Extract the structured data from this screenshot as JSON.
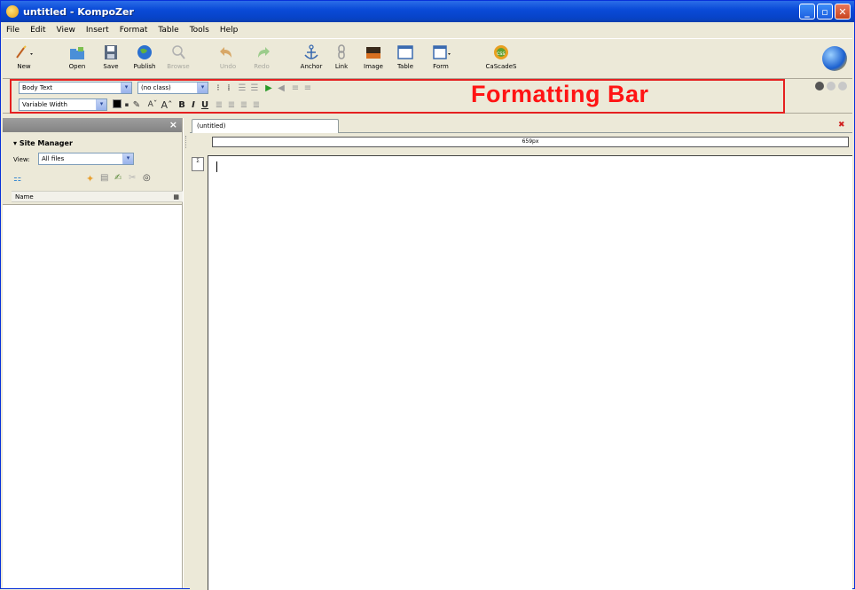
{
  "window": {
    "title": "untitled - KompoZer"
  },
  "menu": [
    "File",
    "Edit",
    "View",
    "Insert",
    "Format",
    "Table",
    "Tools",
    "Help"
  ],
  "toolbar": {
    "items": [
      {
        "label": "New",
        "icon": "new-page-icon",
        "enabled": true
      },
      {
        "label": "Open",
        "icon": "open-folder-icon",
        "enabled": true
      },
      {
        "label": "Save",
        "icon": "save-disk-icon",
        "enabled": true
      },
      {
        "label": "Publish",
        "icon": "publish-globe-icon",
        "enabled": true
      },
      {
        "label": "Browse",
        "icon": "browse-magnifier-icon",
        "enabled": false
      },
      {
        "label": "Undo",
        "icon": "undo-arrow-icon",
        "enabled": false
      },
      {
        "label": "Redo",
        "icon": "redo-arrow-icon",
        "enabled": false
      },
      {
        "label": "Anchor",
        "icon": "anchor-icon",
        "enabled": true
      },
      {
        "label": "Link",
        "icon": "link-chain-icon",
        "enabled": true
      },
      {
        "label": "Image",
        "icon": "image-icon",
        "enabled": true
      },
      {
        "label": "Table",
        "icon": "table-icon",
        "enabled": true
      },
      {
        "label": "Form",
        "icon": "form-icon",
        "enabled": true
      },
      {
        "label": "CaScadeS",
        "icon": "cascades-css-icon",
        "enabled": true
      }
    ]
  },
  "format": {
    "paragraph_style": "Body Text",
    "class": "(no class)",
    "font": "Variable Width"
  },
  "annotation": "Formatting  Bar",
  "site_manager": {
    "title": "Site Manager",
    "view_label": "View:",
    "view_value": "All files",
    "column_name": "Name"
  },
  "editor": {
    "tab_label": "(untitled)",
    "ruler_label": "659px",
    "body_tag": "Σ"
  },
  "colors": {
    "title_bar": "#0a4bd8",
    "highlight": "#e52020"
  }
}
